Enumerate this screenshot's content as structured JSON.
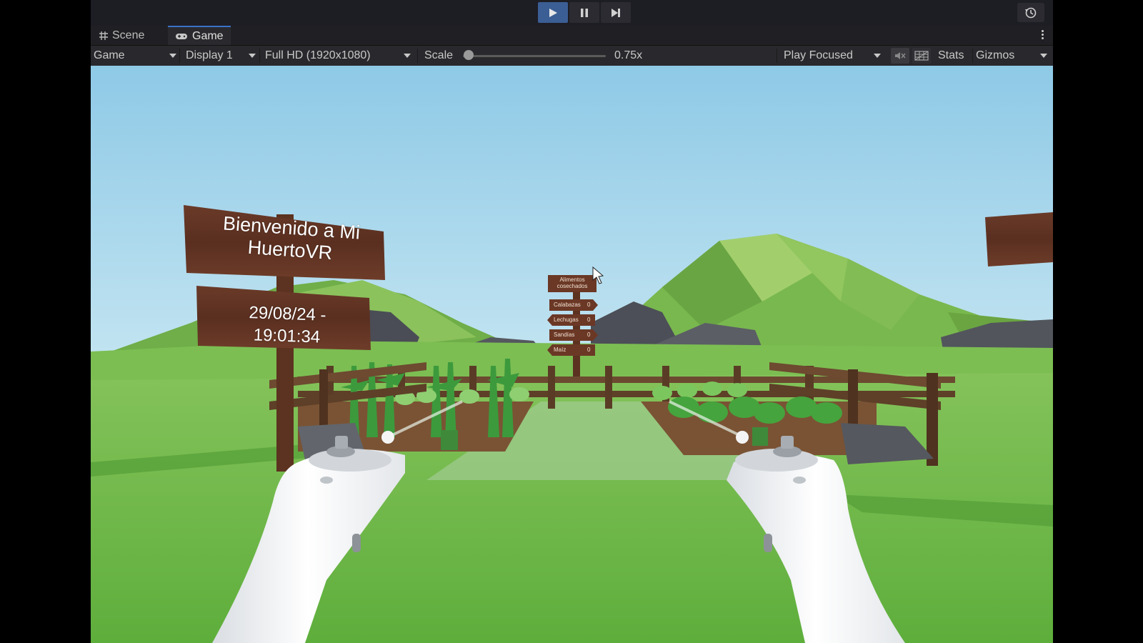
{
  "editor": {
    "tabs": [
      {
        "label": "Scene",
        "icon": "grid-icon"
      },
      {
        "label": "Game",
        "icon": "gamepad-icon"
      }
    ],
    "toolbar": {
      "view_dropdown": "Game",
      "display_dropdown": "Display 1",
      "resolution_dropdown": "Full HD (1920x1080)",
      "scale_label": "Scale",
      "scale_value_text": "0.75x",
      "scale_level": 0.75,
      "play_mode_dropdown": "Play Focused",
      "stats_label": "Stats",
      "gizmos_label": "Gizmos"
    },
    "play_controls": {
      "play_active": true
    },
    "colors": {
      "accent": "#3b5e95",
      "tab_highlight": "#3a72c8",
      "sky_top": "#8ec9e6",
      "grass": "#6fba4a"
    }
  },
  "scene": {
    "welcome_sign": {
      "line1": "Bienvenido a Mi",
      "line2": "HuertoVR"
    },
    "datetime_sign": {
      "line1": "29/08/24 -",
      "line2": "19:01:34"
    },
    "harvest_board": {
      "title_line1": "Alimentos",
      "title_line2": "cosechados",
      "items": [
        {
          "label": "Calabazas",
          "count": "0"
        },
        {
          "label": "Lechugas",
          "count": "0"
        },
        {
          "label": "Sandías",
          "count": "0"
        },
        {
          "label": "Maíz",
          "count": "0"
        }
      ]
    }
  }
}
